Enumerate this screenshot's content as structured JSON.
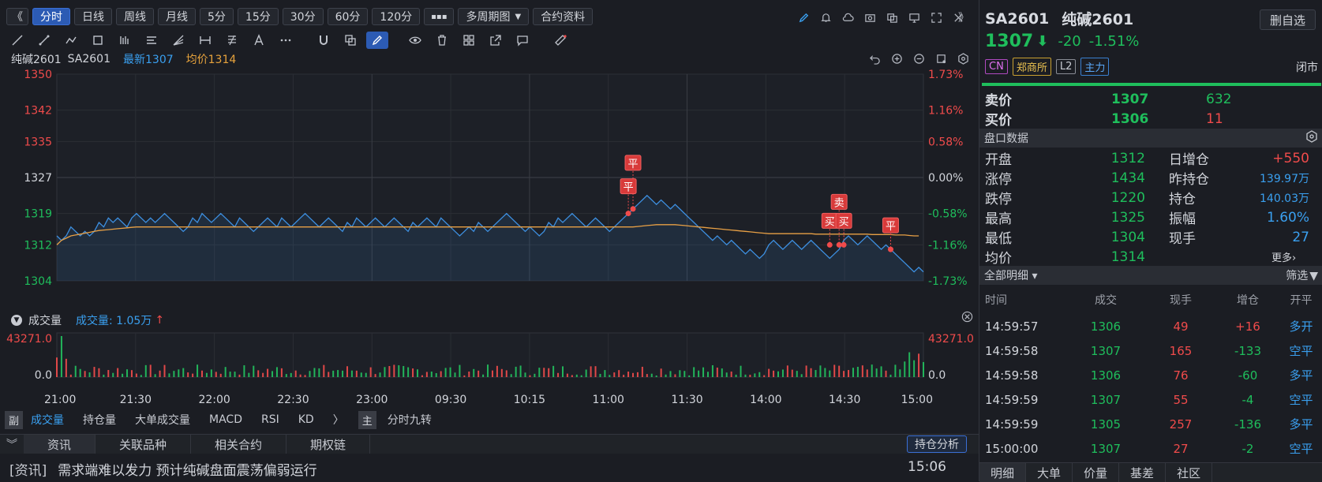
{
  "toolbar": {
    "collapse_glyph": "《",
    "periods": [
      "分时",
      "日线",
      "周线",
      "月线",
      "5分",
      "15分",
      "30分",
      "60分",
      "120分"
    ],
    "active_period": "分时",
    "more_glyph": "▪▪▪",
    "multi_period": "多周期图",
    "contract_info": "合约资料",
    "expand_glyph": "》"
  },
  "chart_info": {
    "name": "纯碱2601",
    "code": "SA2601",
    "latest_label": "最新1307",
    "avg_label": "均价1314"
  },
  "chart_data": [
    {
      "type": "line",
      "y_left_ticks": [
        "1350",
        "1342",
        "1335",
        "1327",
        "1319",
        "1312",
        "1304"
      ],
      "y_right_ticks": [
        "1.73%",
        "1.16%",
        "0.58%",
        "0.00%",
        "-0.58%",
        "-1.16%",
        "-1.73%"
      ],
      "ylim": [
        1304,
        1350
      ],
      "base": 1327,
      "x_ticks": [
        "21:00",
        "21:30",
        "22:00",
        "22:30",
        "23:00",
        "09:30",
        "10:15",
        "11:00",
        "11:30",
        "14:00",
        "14:30",
        "15:00"
      ],
      "series": [
        {
          "name": "最新",
          "color": "#3d8fe0",
          "values": [
            1314,
            1313,
            1314,
            1316,
            1315,
            1314,
            1315,
            1314,
            1315,
            1317,
            1316,
            1318,
            1317,
            1318,
            1317,
            1316,
            1318,
            1319,
            1318,
            1317,
            1318,
            1317,
            1318,
            1319,
            1318,
            1317,
            1316,
            1315,
            1316,
            1318,
            1317,
            1319,
            1318,
            1317,
            1318,
            1319,
            1318,
            1317,
            1316,
            1318,
            1317,
            1316,
            1315,
            1316,
            1317,
            1318,
            1317,
            1316,
            1318,
            1317,
            1316,
            1317,
            1318,
            1319,
            1318,
            1317,
            1316,
            1317,
            1318,
            1317,
            1316,
            1315,
            1317,
            1316,
            1318,
            1317,
            1316,
            1317,
            1318,
            1317,
            1316,
            1317,
            1318,
            1317,
            1316,
            1315,
            1317,
            1316,
            1317,
            1318,
            1317,
            1316,
            1318,
            1317,
            1316,
            1315,
            1314,
            1315,
            1316,
            1315,
            1317,
            1316,
            1315,
            1316,
            1317,
            1318,
            1319,
            1318,
            1317,
            1316,
            1315,
            1316,
            1315,
            1314,
            1315,
            1317,
            1316,
            1318,
            1317,
            1318,
            1319,
            1318,
            1317,
            1316,
            1317,
            1318,
            1317,
            1316,
            1315,
            1316,
            1317,
            1318,
            1319,
            1320,
            1321,
            1322,
            1323,
            1322,
            1321,
            1322,
            1321,
            1320,
            1321,
            1320,
            1319,
            1318,
            1317,
            1316,
            1315,
            1314,
            1313,
            1314,
            1313,
            1312,
            1313,
            1312,
            1311,
            1310,
            1311,
            1310,
            1309,
            1310,
            1312,
            1313,
            1312,
            1311,
            1312,
            1313,
            1312,
            1311,
            1312,
            1313,
            1312,
            1311,
            1310,
            1309,
            1310,
            1311,
            1313,
            1314,
            1313,
            1312,
            1313,
            1314,
            1313,
            1312,
            1311,
            1312,
            1311,
            1310,
            1309,
            1308,
            1307,
            1306,
            1307,
            1306
          ]
        },
        {
          "name": "均价",
          "color": "#e8a045",
          "values": [
            1312,
            1313,
            1313.5,
            1314,
            1314.2,
            1314.4,
            1314.6,
            1314.8,
            1315,
            1315.2,
            1315.3,
            1315.4,
            1315.5,
            1315.6,
            1315.7,
            1315.8,
            1315.9,
            1316,
            1316,
            1316,
            1316,
            1316,
            1316,
            1316,
            1316,
            1316,
            1316,
            1316,
            1316,
            1316,
            1316,
            1316,
            1316,
            1316,
            1316,
            1316,
            1316,
            1316,
            1316,
            1316,
            1316,
            1316,
            1316,
            1316,
            1316,
            1316,
            1316,
            1316,
            1316,
            1316,
            1316,
            1316,
            1316,
            1316,
            1316,
            1316,
            1316,
            1316,
            1316,
            1316,
            1316,
            1316,
            1316,
            1316,
            1316,
            1316,
            1316,
            1316,
            1316,
            1316,
            1316,
            1316,
            1316,
            1316,
            1316,
            1316,
            1316,
            1316,
            1316,
            1316,
            1316,
            1316,
            1316,
            1316,
            1316,
            1316,
            1316,
            1316,
            1316,
            1316,
            1316,
            1316,
            1316,
            1316,
            1316,
            1316,
            1316,
            1316,
            1316,
            1316,
            1316,
            1316,
            1316,
            1316,
            1316,
            1316,
            1316,
            1316,
            1316,
            1316,
            1316,
            1316,
            1316,
            1316,
            1316,
            1316,
            1316,
            1316,
            1316,
            1316,
            1316,
            1316,
            1316,
            1316,
            1316.1,
            1316.2,
            1316.3,
            1316.4,
            1316.5,
            1316.5,
            1316.5,
            1316.5,
            1316.5,
            1316.4,
            1316.3,
            1316.2,
            1316.1,
            1316,
            1315.9,
            1315.8,
            1315.7,
            1315.6,
            1315.5,
            1315.4,
            1315.3,
            1315.2,
            1315.1,
            1315,
            1314.9,
            1314.8,
            1314.7,
            1314.6,
            1314.5,
            1314.5,
            1314.5,
            1314.5,
            1314.5,
            1314.5,
            1314.5,
            1314.5,
            1314.5,
            1314.5,
            1314.4,
            1314.4,
            1314.4,
            1314.4,
            1314.4,
            1314.4,
            1314.4,
            1314.4,
            1314.4,
            1314.4,
            1314.4,
            1314.4,
            1314.3,
            1314.3,
            1314.3,
            1314.3,
            1314.3,
            1314.2,
            1314.2,
            1314.2,
            1314.1,
            1314,
            1314
          ]
        }
      ]
    },
    {
      "type": "bar",
      "title": "成交量",
      "label": "成交量: 1.05万",
      "y_ticks_left": [
        "43271.0",
        "0.0"
      ],
      "y_ticks_right": [
        "43271.0",
        "0.0"
      ],
      "ylim": [
        0,
        43271
      ]
    }
  ],
  "markers": [
    {
      "text": "平",
      "index": 123,
      "price": 1320
    },
    {
      "text": "平",
      "index": 122,
      "price": 1319
    },
    {
      "text": "买",
      "index": 165,
      "price": 1312
    },
    {
      "text": "买",
      "index": 168,
      "price": 1312
    },
    {
      "text": "卖",
      "index": 167,
      "price": 1312
    },
    {
      "text": "平",
      "index": 178,
      "price": 1311
    }
  ],
  "indicator_tabs": {
    "side_label": "副",
    "tabs": [
      "成交量",
      "持仓量",
      "大单成交量",
      "MACD",
      "RSI",
      "KD"
    ],
    "active": "成交量",
    "arrow": "〉",
    "main_label": "主",
    "main_tab": "分时九转"
  },
  "news": {
    "tabs": [
      "资讯",
      "关联品种",
      "相关合约",
      "期权链"
    ],
    "active": "资讯",
    "holding_btn": "持仓分析",
    "headline_tag": "[资讯]",
    "headline": "需求端难以发力 预计纯碱盘面震荡偏弱运行",
    "time": "15:06"
  },
  "quote": {
    "code": "SA2601",
    "name": "纯碱2601",
    "price": "1307",
    "change": "-20",
    "pct": "-1.51%",
    "tags": [
      "CN",
      "郑商所",
      "L2",
      "主力"
    ],
    "status": "闭市",
    "delete_btn": "删自选",
    "sell": {
      "label": "卖价",
      "price": "1307",
      "vol": "632"
    },
    "buy": {
      "label": "买价",
      "price": "1306",
      "vol": "11"
    },
    "panel_title": "盘口数据",
    "stats": [
      [
        "开盘",
        "1312",
        "日增仓",
        "+550"
      ],
      [
        "涨停",
        "1434",
        "昨持仓",
        "139.97万"
      ],
      [
        "跌停",
        "1220",
        "持仓",
        "140.03万"
      ],
      [
        "最高",
        "1325",
        "振幅",
        "1.60%"
      ],
      [
        "最低",
        "1304",
        "现手",
        "27"
      ],
      [
        "均价",
        "1314",
        "",
        ""
      ]
    ],
    "more": "更多›",
    "detail_title": "全部明细 ▾",
    "filter": "筛选",
    "tick_headers": [
      "时间",
      "成交",
      "现手",
      "增仓",
      "开平"
    ],
    "ticks": [
      [
        "14:59:57",
        "1306",
        "49",
        "+16",
        "多开"
      ],
      [
        "14:59:58",
        "1307",
        "165",
        "-133",
        "空平"
      ],
      [
        "14:59:58",
        "1306",
        "76",
        "-60",
        "多平"
      ],
      [
        "14:59:59",
        "1307",
        "55",
        "-4",
        "空平"
      ],
      [
        "14:59:59",
        "1305",
        "257",
        "-136",
        "多平"
      ],
      [
        "15:00:00",
        "1307",
        "27",
        "-2",
        "空平"
      ]
    ],
    "bottom_tabs": [
      "明细",
      "大单",
      "价量",
      "基差",
      "社区"
    ]
  }
}
